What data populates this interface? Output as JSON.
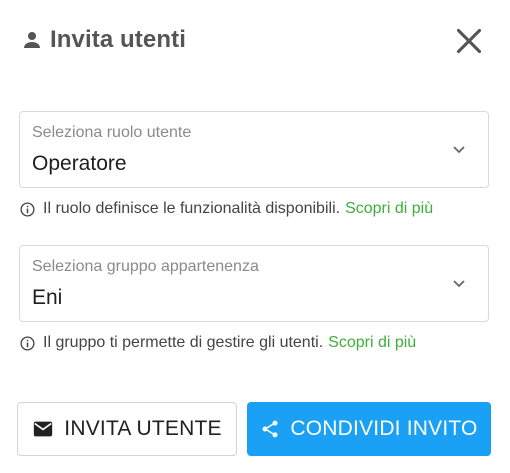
{
  "dialog": {
    "title": "Invita utenti",
    "icons": {
      "header": "person-icon",
      "close": "close-icon"
    }
  },
  "role_select": {
    "label": "Seleziona ruolo utente",
    "value": "Operatore",
    "icon": "chevron-down-icon"
  },
  "role_help": {
    "text": "Il ruolo definisce le funzionalità disponibili.",
    "link": "Scopri di più",
    "icon": "info-icon"
  },
  "group_select": {
    "label": "Seleziona gruppo appartenenza",
    "value": "Eni",
    "icon": "chevron-down-icon"
  },
  "group_help": {
    "text": "Il gruppo ti permette di gestire gli utenti.",
    "link": "Scopri di più",
    "icon": "info-icon"
  },
  "actions": {
    "invite_label": "INVITA UTENTE",
    "invite_icon": "mail-icon",
    "share_label": "CONDIVIDI INVITO",
    "share_icon": "share-icon"
  },
  "colors": {
    "accent": "#1aa1f5",
    "link": "#3fae3b",
    "title": "#555555"
  }
}
